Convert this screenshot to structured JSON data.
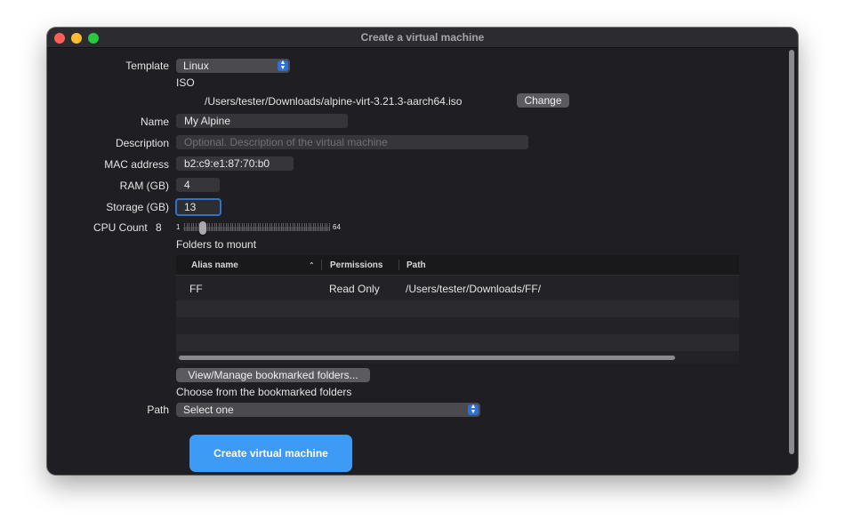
{
  "window": {
    "title": "Create a virtual machine"
  },
  "form": {
    "template": {
      "label": "Template",
      "value": "Linux"
    },
    "iso": {
      "label": "ISO",
      "path": "/Users/tester/Downloads/alpine-virt-3.21.3-aarch64.iso",
      "change_label": "Change"
    },
    "name": {
      "label": "Name",
      "value": "My Alpine"
    },
    "description": {
      "label": "Description",
      "placeholder": "Optional. Description of the virtual machine"
    },
    "mac": {
      "label": "MAC address",
      "value": "b2:c9:e1:87:70:b0"
    },
    "ram": {
      "label": "RAM (GB)",
      "value": "4"
    },
    "storage": {
      "label": "Storage (GB)",
      "value": "13"
    },
    "cpu": {
      "label": "CPU Count",
      "value": "8",
      "min_label": "1",
      "max_label": "64"
    }
  },
  "folders": {
    "title": "Folders to mount",
    "columns": [
      "Alias name",
      "Permissions",
      "Path"
    ],
    "rows": [
      {
        "alias": "FF",
        "permissions": "Read Only",
        "path": "/Users/tester/Downloads/FF/"
      }
    ],
    "manage_label": "View/Manage bookmarked folders...",
    "choose_label": "Choose from the bookmarked folders",
    "path_label": "Path",
    "path_value": "Select one"
  },
  "actions": {
    "create_label": "Create virtual machine"
  },
  "colors": {
    "accent": "#3d9bf5",
    "window_bg": "#1f1f23",
    "focus_ring": "#2f73c9"
  }
}
